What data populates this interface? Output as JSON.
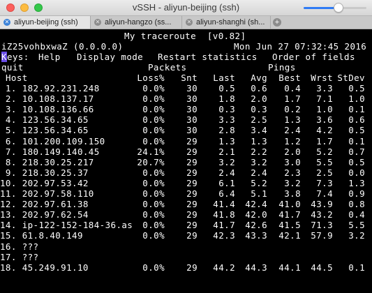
{
  "window": {
    "title": "vSSH - aliyun-beijing (ssh)"
  },
  "font_slider": {
    "value": 0.55,
    "accent": "#2f7bf5"
  },
  "tabs": [
    {
      "label": "aliyun-beijing (ssh)",
      "active": true
    },
    {
      "label": "aliyun-hangzo (ss...",
      "active": false
    },
    {
      "label": "aliyun-shanghi (sh...",
      "active": false
    }
  ],
  "icons": {
    "close_tab": "close-icon",
    "add_tab": "plus-icon"
  },
  "terminal": {
    "app_title": "My traceroute  [v0.82]",
    "host_line": "iZ25vohbxwaZ (0.0.0.0)",
    "date_line": "Mon Jun 27 07:32:45 2016",
    "keys_label": "Keys:",
    "menu": [
      "Help",
      "Display mode",
      "Restart statistics",
      "Order of fields"
    ],
    "quit": "quit",
    "group_packets": "Packets",
    "group_pings": "Pings",
    "headers": [
      "Host",
      "Loss%",
      "Snt",
      "Last",
      "Avg",
      "Best",
      "Wrst",
      "StDev"
    ],
    "rows": [
      [
        "1. 182.92.231.248",
        "0.0%",
        "30",
        "0.5",
        "0.6",
        "0.4",
        "3.3",
        "0.5"
      ],
      [
        "2. 10.108.137.17",
        "0.0%",
        "30",
        "1.8",
        "2.0",
        "1.7",
        "7.1",
        "1.0"
      ],
      [
        "3. 10.108.136.66",
        "0.0%",
        "30",
        "0.3",
        "0.3",
        "0.2",
        "1.0",
        "0.1"
      ],
      [
        "4. 123.56.34.65",
        "0.0%",
        "30",
        "3.3",
        "2.5",
        "1.3",
        "3.6",
        "0.6"
      ],
      [
        "5. 123.56.34.65",
        "0.0%",
        "30",
        "2.8",
        "3.4",
        "2.4",
        "4.2",
        "0.5"
      ],
      [
        "6. 101.200.109.150",
        "0.0%",
        "29",
        "1.3",
        "1.3",
        "1.2",
        "1.7",
        "0.1"
      ],
      [
        "7. 180.149.140.45",
        "24.1%",
        "29",
        "2.1",
        "2.2",
        "2.0",
        "5.2",
        "0.7"
      ],
      [
        "8. 218.30.25.217",
        "20.7%",
        "29",
        "3.2",
        "3.2",
        "3.0",
        "5.5",
        "0.5"
      ],
      [
        "9. 218.30.25.37",
        "0.0%",
        "29",
        "2.4",
        "2.4",
        "2.3",
        "2.5",
        "0.0"
      ],
      [
        "10. 202.97.53.42",
        "0.0%",
        "29",
        "6.1",
        "5.2",
        "3.2",
        "7.3",
        "1.3"
      ],
      [
        "11. 202.97.58.110",
        "0.0%",
        "29",
        "6.4",
        "5.1",
        "3.8",
        "7.4",
        "0.9"
      ],
      [
        "12. 202.97.61.38",
        "0.0%",
        "29",
        "41.4",
        "42.4",
        "41.0",
        "43.9",
        "0.8"
      ],
      [
        "13. 202.97.62.54",
        "0.0%",
        "29",
        "41.8",
        "42.0",
        "41.7",
        "43.2",
        "0.4"
      ],
      [
        "14. ip-122-152-184-36.as",
        "0.0%",
        "29",
        "41.7",
        "42.6",
        "41.5",
        "71.3",
        "5.5"
      ],
      [
        "15. 61.8.40.149",
        "0.0%",
        "29",
        "42.3",
        "43.3",
        "42.1",
        "57.9",
        "3.2"
      ],
      [
        "16. ???",
        "",
        "",
        "",
        "",
        "",
        "",
        ""
      ],
      [
        "17. ???",
        "",
        "",
        "",
        "",
        "",
        "",
        ""
      ],
      [
        "18. 45.249.91.10",
        "0.0%",
        "29",
        "44.2",
        "44.3",
        "44.1",
        "44.5",
        "0.1"
      ]
    ]
  }
}
